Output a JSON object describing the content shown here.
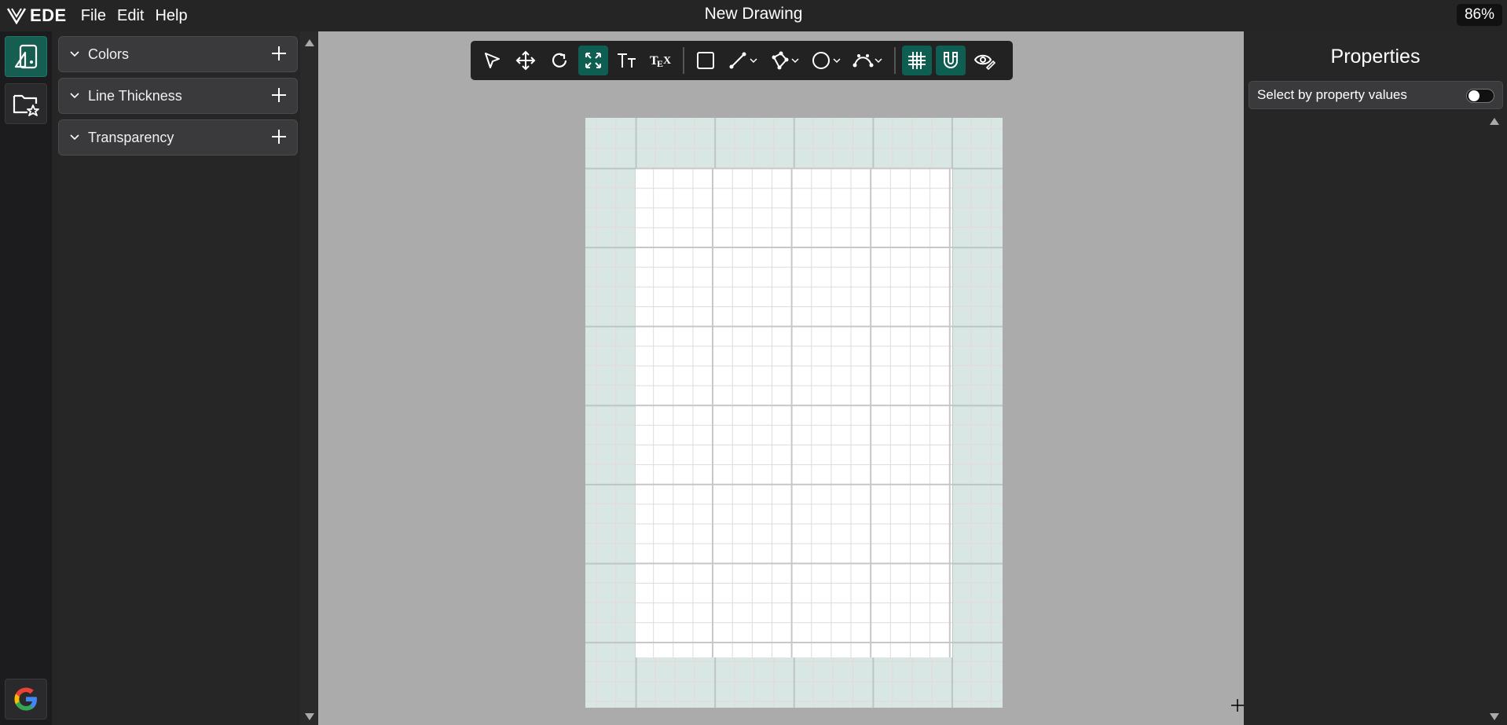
{
  "app": {
    "logo_text": "EDE",
    "title": "New Drawing",
    "zoom": "86%"
  },
  "menu": [
    "File",
    "Edit",
    "Help"
  ],
  "rail": [
    {
      "icon": "shapes-panel-icon",
      "active": true
    },
    {
      "icon": "favorites-folder-icon",
      "active": false
    },
    {
      "icon": "google-icon",
      "active": false
    }
  ],
  "left_panel": {
    "sections": [
      {
        "label": "Colors"
      },
      {
        "label": "Line Thickness"
      },
      {
        "label": "Transparency"
      }
    ]
  },
  "toolbar": {
    "tools": [
      {
        "icon": "select-arrow-icon",
        "active": false
      },
      {
        "icon": "move-icon",
        "active": false
      },
      {
        "icon": "rotate-icon",
        "active": false
      },
      {
        "icon": "scale-icon",
        "active": true
      },
      {
        "icon": "text-icon",
        "active": false
      },
      {
        "icon": "tex-icon",
        "active": false
      },
      {
        "icon": "rectangle-icon",
        "active": false
      },
      {
        "icon": "line-icon",
        "active": false
      },
      {
        "icon": "polygon-icon",
        "active": false
      },
      {
        "icon": "circle-icon",
        "active": false
      },
      {
        "icon": "bezier-icon",
        "active": false
      },
      {
        "icon": "grid-icon",
        "active": true
      },
      {
        "icon": "snap-magnet-icon",
        "active": true
      },
      {
        "icon": "visibility-icon",
        "active": false
      }
    ]
  },
  "right_panel": {
    "title": "Properties",
    "select_by_property": {
      "label": "Select by property values",
      "enabled": false
    }
  },
  "colors": {
    "accent": "#155e51",
    "canvas": "#ababab",
    "page_margin": "#d8e6e4"
  }
}
